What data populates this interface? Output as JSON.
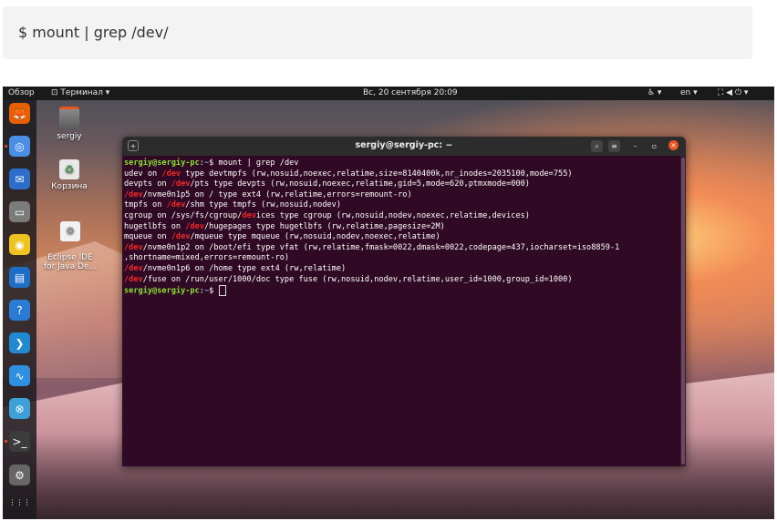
{
  "code_block": {
    "command": "$ mount | grep /dev/"
  },
  "topbar": {
    "activities": "Обзор",
    "app_menu": "Терминал ▾",
    "datetime": "Вс, 20 сентября  20:09",
    "accessibility": "♿ ▾",
    "lang": "en ▾",
    "status": "⛶ ◀ ⏻ ▾"
  },
  "desktop_icons": [
    {
      "label": "sergiy"
    },
    {
      "label": "Корзина"
    },
    {
      "label": "Eclipse IDE\nfor Java De..."
    }
  ],
  "dock": [
    {
      "name": "firefox",
      "color": "#e66000",
      "glyph": "🦊"
    },
    {
      "name": "chromium",
      "color": "#4a8ee6",
      "glyph": "◎"
    },
    {
      "name": "thunderbird",
      "color": "#2c6ec9",
      "glyph": "✉"
    },
    {
      "name": "files",
      "color": "#7b7b7b",
      "glyph": "▭"
    },
    {
      "name": "rhythmbox",
      "color": "#f0c420",
      "glyph": "◉"
    },
    {
      "name": "libreoffice-writer",
      "color": "#1e6ec8",
      "glyph": "▤"
    },
    {
      "name": "help",
      "color": "#2a7bd5",
      "glyph": "?"
    },
    {
      "name": "vscode",
      "color": "#1f8ad2",
      "glyph": "❯"
    },
    {
      "name": "system-monitor",
      "color": "#2f8fe0",
      "glyph": "∿"
    },
    {
      "name": "software-updater",
      "color": "#3da0d8",
      "glyph": "⊗"
    },
    {
      "name": "terminal",
      "color": "#3c3c3c",
      "glyph": ">_"
    },
    {
      "name": "settings",
      "color": "#666666",
      "glyph": "⚙"
    },
    {
      "name": "show-apps",
      "color": "transparent",
      "glyph": "⋮⋮⋮"
    }
  ],
  "terminal": {
    "title": "sergiy@sergiy-pc: ~",
    "prompt_user": "sergiy@sergiy-pc",
    "prompt_path": "~",
    "command": "$ mount | grep /dev",
    "lines": [
      {
        "pre": "udev on ",
        "dev": "/dev",
        "post": " type devtmpfs (rw,nosuid,noexec,relatime,size=8140400k,nr_inodes=2035100,mode=755)"
      },
      {
        "pre": "devpts on ",
        "dev": "/dev",
        "post": "/pts type devpts (rw,nosuid,noexec,relatime,gid=5,mode=620,ptmxmode=000)"
      },
      {
        "pre": "",
        "dev": "/dev",
        "post": "/nvme0n1p5 on / type ext4 (rw,relatime,errors=remount-ro)"
      },
      {
        "pre": "tmpfs on ",
        "dev": "/dev",
        "post": "/shm type tmpfs (rw,nosuid,nodev)"
      },
      {
        "pre": "cgroup on /sys/fs/cgroup/",
        "dev": "dev",
        "post": "ices type cgroup (rw,nosuid,nodev,noexec,relatime,devices)"
      },
      {
        "pre": "hugetlbfs on ",
        "dev": "/dev",
        "post": "/hugepages type hugetlbfs (rw,relatime,pagesize=2M)"
      },
      {
        "pre": "mqueue on ",
        "dev": "/dev",
        "post": "/mqueue type mqueue (rw,nosuid,nodev,noexec,relatime)"
      },
      {
        "pre": "",
        "dev": "/dev",
        "post": "/nvme0n1p2 on /boot/efi type vfat (rw,relatime,fmask=0022,dmask=0022,codepage=437,iocharset=iso8859-1"
      },
      {
        "pre": ",shortname=mixed,errors=remount-ro)",
        "dev": "",
        "post": ""
      },
      {
        "pre": "",
        "dev": "/dev",
        "post": "/nvme0n1p6 on /home type ext4 (rw,relatime)"
      },
      {
        "pre": "",
        "dev": "/dev",
        "post": "/fuse on /run/user/1000/doc type fuse (rw,nosuid,nodev,relatime,user_id=1000,group_id=1000)"
      }
    ],
    "final_prompt": "$ "
  }
}
